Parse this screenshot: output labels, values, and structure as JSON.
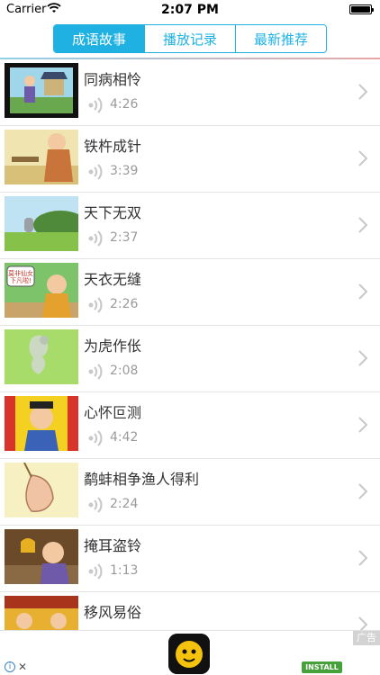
{
  "status_bar": {
    "carrier": "Carrier",
    "time": "2:07 PM"
  },
  "tabs": [
    {
      "label": "成语故事",
      "active": true
    },
    {
      "label": "播放记录",
      "active": false
    },
    {
      "label": "最新推荐",
      "active": false
    }
  ],
  "list": [
    {
      "title": "同病相怜",
      "duration": "4:26"
    },
    {
      "title": "铁杵成针",
      "duration": "3:39"
    },
    {
      "title": "天下无双",
      "duration": "2:37"
    },
    {
      "title": "天衣无缝",
      "duration": "2:26",
      "thumb_caption": "莫非仙女下凡啦!"
    },
    {
      "title": "为虎作伥",
      "duration": "2:08"
    },
    {
      "title": "心怀叵测",
      "duration": "4:42"
    },
    {
      "title": "鹬蚌相争渔人得利",
      "duration": "2:24"
    },
    {
      "title": "掩耳盗铃",
      "duration": "1:13"
    },
    {
      "title": "移风易俗",
      "duration": ""
    }
  ],
  "ad": {
    "tag": "广告",
    "install_label": "INSTALL"
  },
  "colors": {
    "accent": "#1fb1e2",
    "install": "#46a13a"
  }
}
